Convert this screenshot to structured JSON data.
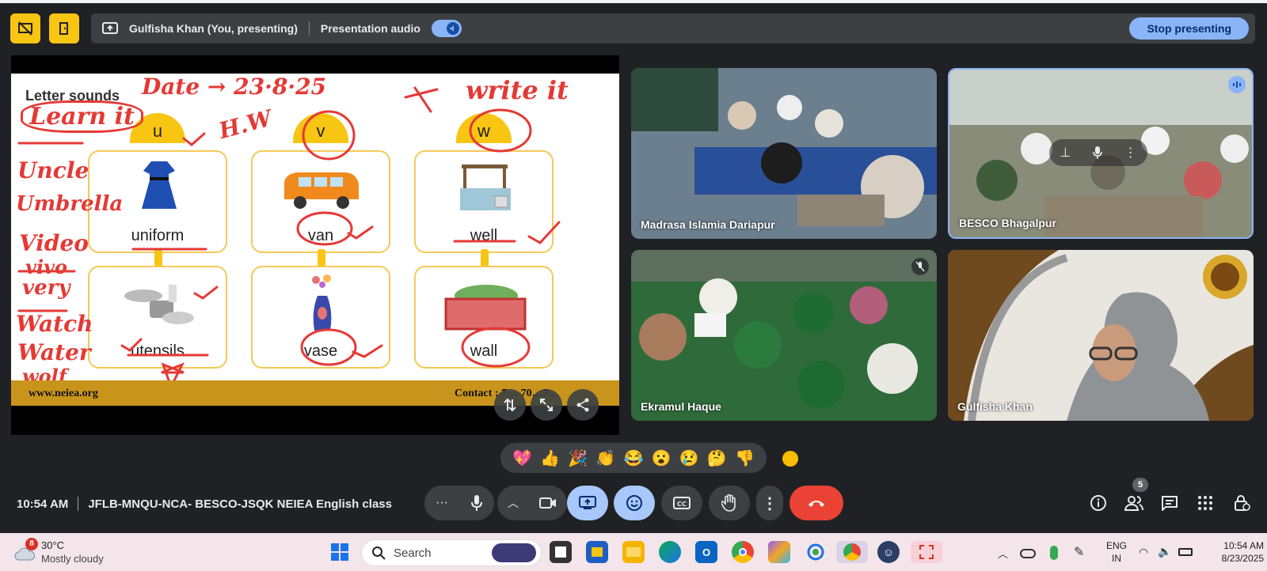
{
  "presenting": {
    "presenter": "Gulfisha Khan (You, presenting)",
    "audio_label": "Presentation audio",
    "stop_label": "Stop presenting"
  },
  "slide": {
    "title": "Letter sounds",
    "website": "www.neiea.org",
    "contact": "Contact : 7… 70…7…",
    "letters": [
      "u",
      "v",
      "w"
    ],
    "words": [
      "uniform",
      "van",
      "well",
      "utensils",
      "vase",
      "wall"
    ],
    "annotations": {
      "date": "Date → 23·8·25",
      "learn": "Learn it",
      "write": "write it",
      "hw": "H.W",
      "vocab": [
        "Uncle",
        "Umbrella",
        "Video",
        "vivo",
        "very",
        "Watch",
        "Water",
        "wolf"
      ]
    }
  },
  "participants": [
    {
      "name": "Madrasa Islamia Dariapur",
      "color": "#6b7f8f"
    },
    {
      "name": "BESCO Bhagalpur",
      "color": "#8a8c7a"
    },
    {
      "name": "Ekramul Haque",
      "color": "#2f6b3a"
    },
    {
      "name": "Gulfisha Khan",
      "color": "#e9e6df"
    }
  ],
  "reactions": [
    "💖",
    "👍",
    "🎉",
    "👏",
    "😂",
    "😮",
    "😢",
    "🤔",
    "👎"
  ],
  "meeting": {
    "time": "10:54 AM",
    "title": "JFLB-MNQU-NCA- BESCO-JSQK NEIEA English class",
    "people_count": "5"
  },
  "taskbar": {
    "weather_badge": "8",
    "temp": "30°C",
    "condition": "Mostly cloudy",
    "search_label": "Search",
    "lang_top": "ENG",
    "lang_bottom": "IN",
    "clock_time": "10:54 AM",
    "clock_date": "8/23/2025"
  },
  "colors": {
    "accent": "#8ab4f8",
    "end_call": "#ea4335",
    "slide_yellow": "#f9c513",
    "annotation_red": "#e53935"
  }
}
